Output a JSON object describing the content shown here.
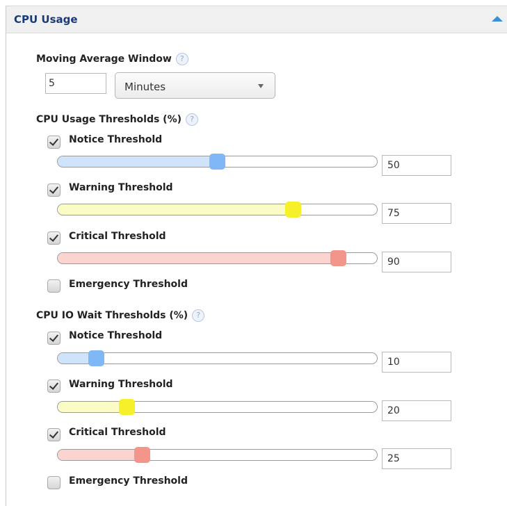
{
  "panel": {
    "title": "CPU Usage"
  },
  "moving_average": {
    "label": "Moving Average Window",
    "help_glyph": "?",
    "value": "5",
    "unit_selected": "Minutes"
  },
  "cpu_usage": {
    "heading": "CPU Usage Thresholds (%)",
    "help_glyph": "?",
    "notice": {
      "label": "Notice Threshold",
      "checked": true,
      "value": "50"
    },
    "warning": {
      "label": "Warning Threshold",
      "checked": true,
      "value": "75"
    },
    "critical": {
      "label": "Critical Threshold",
      "checked": true,
      "value": "90"
    },
    "emergency": {
      "label": "Emergency Threshold",
      "checked": false
    }
  },
  "cpu_io_wait": {
    "heading": "CPU IO Wait Thresholds (%)",
    "help_glyph": "?",
    "notice": {
      "label": "Notice Threshold",
      "checked": true,
      "value": "10"
    },
    "warning": {
      "label": "Warning Threshold",
      "checked": true,
      "value": "20"
    },
    "critical": {
      "label": "Critical Threshold",
      "checked": true,
      "value": "25"
    },
    "emergency": {
      "label": "Emergency Threshold",
      "checked": false
    }
  },
  "colors": {
    "notice_fill": "#cfe4fb",
    "notice_handle": "#7fb8f5",
    "warning_fill": "#fbfbc5",
    "warning_handle": "#f6f02a",
    "critical_fill": "#fbd4d0",
    "critical_handle": "#f4958c"
  }
}
